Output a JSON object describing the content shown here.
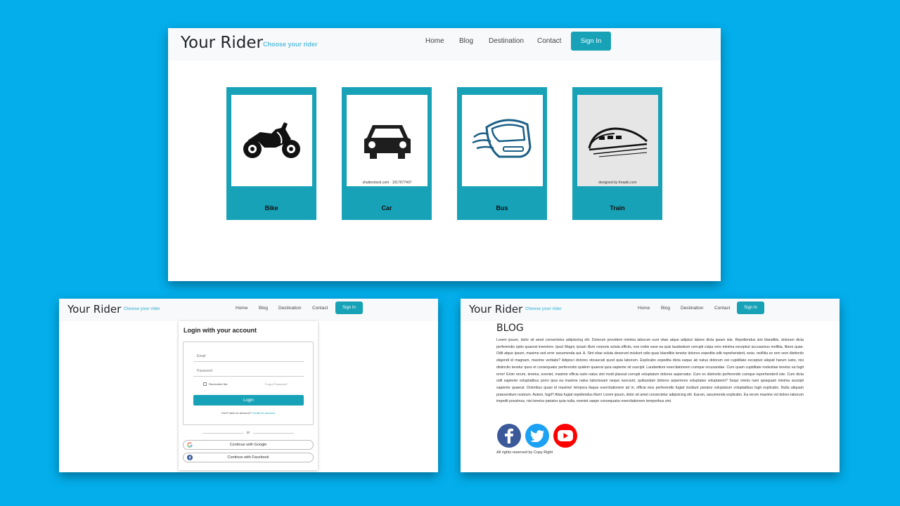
{
  "brand": {
    "name": "Your Rider",
    "tagline": "Choose your rider"
  },
  "nav": {
    "items": [
      "Home",
      "Blog",
      "Destination",
      "Contact"
    ],
    "signin_label": "Sign In"
  },
  "accent_color": "#17a2b8",
  "background_color": "#03aeeb",
  "vehicles": [
    {
      "label": "Bike",
      "icon": "motorbike-icon"
    },
    {
      "label": "Car",
      "icon": "car-icon",
      "credit": "shutterstock.com · 1017677407"
    },
    {
      "label": "Bus",
      "icon": "bus-icon"
    },
    {
      "label": "Train",
      "icon": "train-icon",
      "credit": "designed by freepik.com"
    }
  ],
  "login": {
    "title": "Login with your account",
    "email_placeholder": "Email",
    "password_placeholder": "Password",
    "remember_label": "Remember Me",
    "forgot_label": "Forgot Password?",
    "login_button": "Login",
    "signup_prompt": "Don't have an account?",
    "signup_link": "Create an account",
    "or_label": "or",
    "google_button": "Continue with Google",
    "facebook_button": "Continue with Facebook"
  },
  "blog": {
    "title": "BLOG",
    "body": "Lorem ipsum, dolor sit amet consectetur adipisicing elit. Dolorum provident minima laborum sunt vitae atque adipisci labore dicta ipsam iste. Repellendus sint blanditiis, dolorum dicta perferendis optio quaerat inventore. Ipsa! Magni, ipsam illum corporis soluta officiis, eos nobis esse ea quis laudantium corrupti culpa vero minima excepturi accusamus mollitia, libero quae. Odit atque ipsum, maxime sed error assumenda aut. A. Sint vitae soluta deserunt incidunt odio quas blanditiis tenetur dolores expedita odit reprehenderit, esse, mollitia ex rem vero distinctio eligendi id magnam, maxime veritatis? Adipisci dolores obcaecati quod quia laborum. Explicabo expedita dicta eaque ab natus dolorum est cupiditate excepturi aliquid harum iusto, nisi distinctio tenetur quos et consequatur perferendis quidem quaerat quia sapiente sit suscipit. Laudantium exercitationem cumque recusandae. Cum quam cupiditate molestiae tenetur ea fugit error! Enim rerum, tenetur, eveniet, maxime officia iusto natus sint modi placeat corrupti voluptatum dolores aspernatur. Cum ex distinctio perferendis cumque reprehenderit iste. Cum dicta odit sapiente voluptatibus porro ipsa ea maxime natus laboriosam neque nesciunt, quibusdam dolores asperiores voluptates voluptatem? Sequi omnis nam quisquam minima suscipit sapiente quaerat. Doloribus quasi id maxime! tempora itaque exercitationem ad in, officia eius perferendis fugiat incidunt pariatur voluptatum voluptatibus fugit explicabo. Nulla aliquam praesentium nostrum. Autem, fugit? Alias fugiat repellendus illum! Lorem ipsum, dolor sit amet consectetur adipisicing elit. Earum, assumenda explicabo. Ea rerum maxime vel dolore laborum impedit possimus, nisi tenetur pariatur quia nulla, eveniet saepe consequatur exercitationem temporibus sint.",
    "social": [
      {
        "icon": "facebook-icon",
        "color": "#3b5998"
      },
      {
        "icon": "twitter-icon",
        "color": "#1da1f2"
      },
      {
        "icon": "youtube-icon",
        "color": "#ff0000"
      }
    ],
    "footer": "All rights reserved by Copy Right"
  }
}
